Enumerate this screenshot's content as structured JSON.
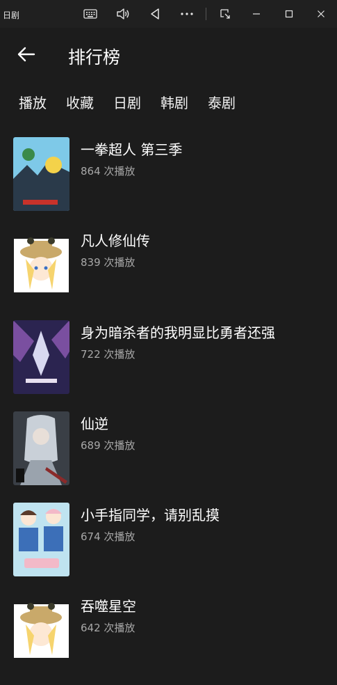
{
  "titlebar": {
    "app_name": "日剧",
    "icons": [
      "keyboard-icon",
      "volume-icon",
      "back-triangle-icon",
      "more-icon",
      "snap-icon",
      "minimize-icon",
      "maximize-icon",
      "close-icon"
    ]
  },
  "header": {
    "title": "排行榜"
  },
  "tabs": [
    {
      "label": "播放"
    },
    {
      "label": "收藏"
    },
    {
      "label": "日剧"
    },
    {
      "label": "韩剧"
    },
    {
      "label": "泰剧"
    }
  ],
  "items": [
    {
      "title": "一拳超人 第三季",
      "plays": "864 次播放",
      "thumb_colors": [
        "#7ec9e8",
        "#2a3a4a",
        "#f4d24a"
      ]
    },
    {
      "title": "凡人修仙传",
      "plays": "839 次播放",
      "thumb_colors": [
        "#ffffff",
        "#c9a96a",
        "#f6d46e"
      ]
    },
    {
      "title": "身为暗杀者的我明显比勇者还强",
      "plays": "722 次播放",
      "thumb_colors": [
        "#2b2450",
        "#7a4fa0",
        "#d8d8f0"
      ]
    },
    {
      "title": "仙逆",
      "plays": "689 次播放",
      "thumb_colors": [
        "#3a3f46",
        "#c9d0d8",
        "#8a2a2a"
      ]
    },
    {
      "title": "小手指同学，请别乱摸",
      "plays": "674 次播放",
      "thumb_colors": [
        "#bfe3f0",
        "#f3b9c8",
        "#3c6fb8"
      ]
    },
    {
      "title": "吞噬星空",
      "plays": "642 次播放",
      "thumb_colors": [
        "#ffffff",
        "#c9a96a",
        "#f6d46e"
      ]
    }
  ],
  "colors": {
    "background": "#1c1c1c",
    "titlebar": "#202020",
    "secondary_text": "#a8a8a8"
  }
}
